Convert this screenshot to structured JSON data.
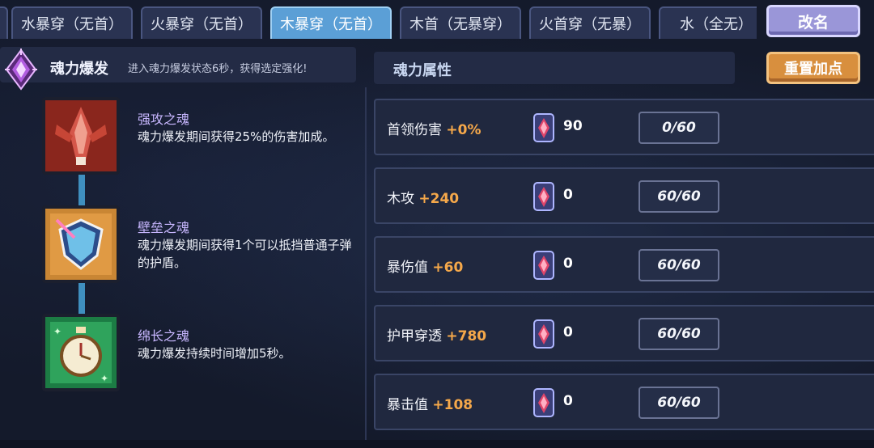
{
  "tabs": [
    {
      "label": "水暴穿（无首）",
      "active": false
    },
    {
      "label": "火暴穿（无首）",
      "active": false
    },
    {
      "label": "木暴穿（无首）",
      "active": true
    },
    {
      "label": "木首（无暴穿）",
      "active": false
    },
    {
      "label": "火首穿（无暴）",
      "active": false
    },
    {
      "label": "水（全无）",
      "active": false
    }
  ],
  "rename_button": "改名",
  "burst": {
    "title": "魂力爆发",
    "description": "进入魂力爆发状态6秒，获得选定强化!",
    "icon": "purple-crystal-icon"
  },
  "skills": [
    {
      "name": "强攻之魂",
      "description": "魂力爆发期间获得25%的伤害加成。",
      "icon": "red-blade-icon"
    },
    {
      "name": "壁垒之魂",
      "description": "魂力爆发期间获得1个可以抵挡普通子弹的护盾。",
      "icon": "shield-icon"
    },
    {
      "name": "绵长之魂",
      "description": "魂力爆发持续时间增加5秒。",
      "icon": "stopwatch-icon"
    }
  ],
  "attributes": {
    "title": "魂力属性",
    "reset_button": "重置加点",
    "rows": [
      {
        "name": "首领伤害",
        "bonus": "+0%",
        "gems": "90",
        "level": "0/60"
      },
      {
        "name": "木攻",
        "bonus": "+240",
        "gems": "0",
        "level": "60/60"
      },
      {
        "name": "暴伤值",
        "bonus": "+60",
        "gems": "0",
        "level": "60/60"
      },
      {
        "name": "护甲穿透",
        "bonus": "+780",
        "gems": "0",
        "level": "60/60"
      },
      {
        "name": "暴击值",
        "bonus": "+108",
        "gems": "0",
        "level": "60/60"
      }
    ],
    "gem_icon": "soul-gem-icon"
  },
  "colors": {
    "active_tab": "#5b9fd6",
    "bonus": "#f5a84a",
    "rename_button": "#9a96d8",
    "reset_button": "#d88f3e"
  }
}
